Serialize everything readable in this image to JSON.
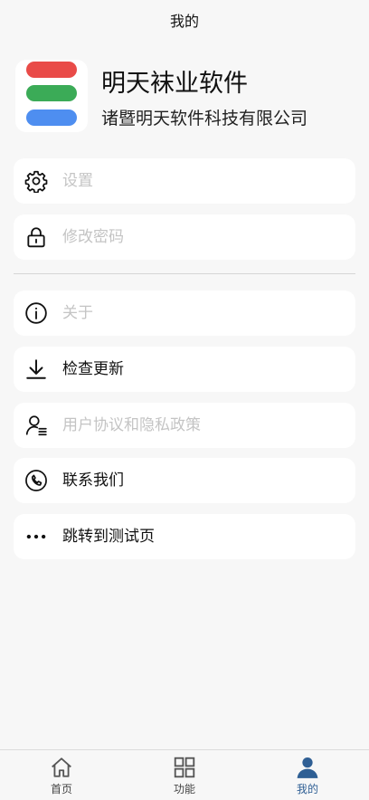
{
  "header": {
    "title": "我的"
  },
  "profile": {
    "app_name": "明天袜业软件",
    "company": "诸暨明天软件科技有限公司"
  },
  "menu": {
    "settings": {
      "label": "设置",
      "icon": "gear-icon"
    },
    "change_password": {
      "label": "修改密码",
      "icon": "lock-icon"
    },
    "about": {
      "label": "关于",
      "icon": "info-icon"
    },
    "check_update": {
      "label": "检查更新",
      "icon": "download-icon"
    },
    "user_agreement": {
      "label": "用户协议和隐私政策",
      "icon": "user-list-icon"
    },
    "contact": {
      "label": "联系我们",
      "icon": "phone-icon"
    },
    "test_page": {
      "label": "跳转到测试页",
      "icon": "more-dots-icon"
    }
  },
  "tabbar": {
    "home": {
      "label": "首页",
      "icon": "home-icon"
    },
    "functions": {
      "label": "功能",
      "icon": "grid-icon"
    },
    "mine": {
      "label": "我的",
      "icon": "person-icon",
      "active": true
    }
  },
  "colors": {
    "accent": "#2f5f94",
    "logo_red": "#e94b48",
    "logo_green": "#3bab57",
    "logo_blue": "#4e8ef0",
    "muted_text": "#c4c4c4"
  }
}
